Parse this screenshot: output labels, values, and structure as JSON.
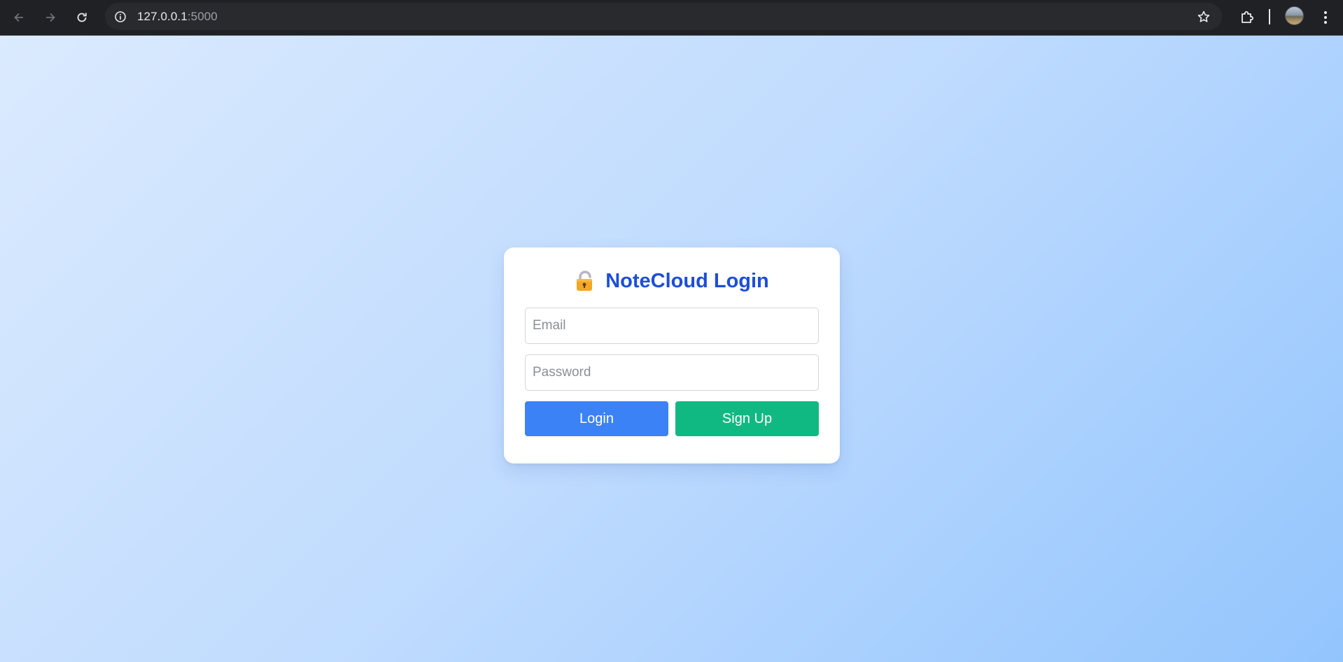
{
  "browser": {
    "url_host": "127.0.0.1",
    "url_port": ":5000",
    "icons": {
      "back": "arrow-left-icon",
      "forward": "arrow-right-icon",
      "reload": "reload-icon",
      "site_info": "info-icon",
      "bookmark": "star-icon",
      "extensions": "puzzle-icon",
      "menu": "kebab-menu-icon"
    }
  },
  "login_card": {
    "icon": "lock-icon",
    "title": "NoteCloud Login",
    "email_placeholder": "Email",
    "email_value": "",
    "password_placeholder": "Password",
    "password_value": "",
    "login_label": "Login",
    "signup_label": "Sign Up"
  },
  "colors": {
    "title": "#1d4ed8",
    "login_button": "#3b82f6",
    "signup_button": "#10b981",
    "background_start": "#dbeafe",
    "background_end": "#93c5fd"
  }
}
